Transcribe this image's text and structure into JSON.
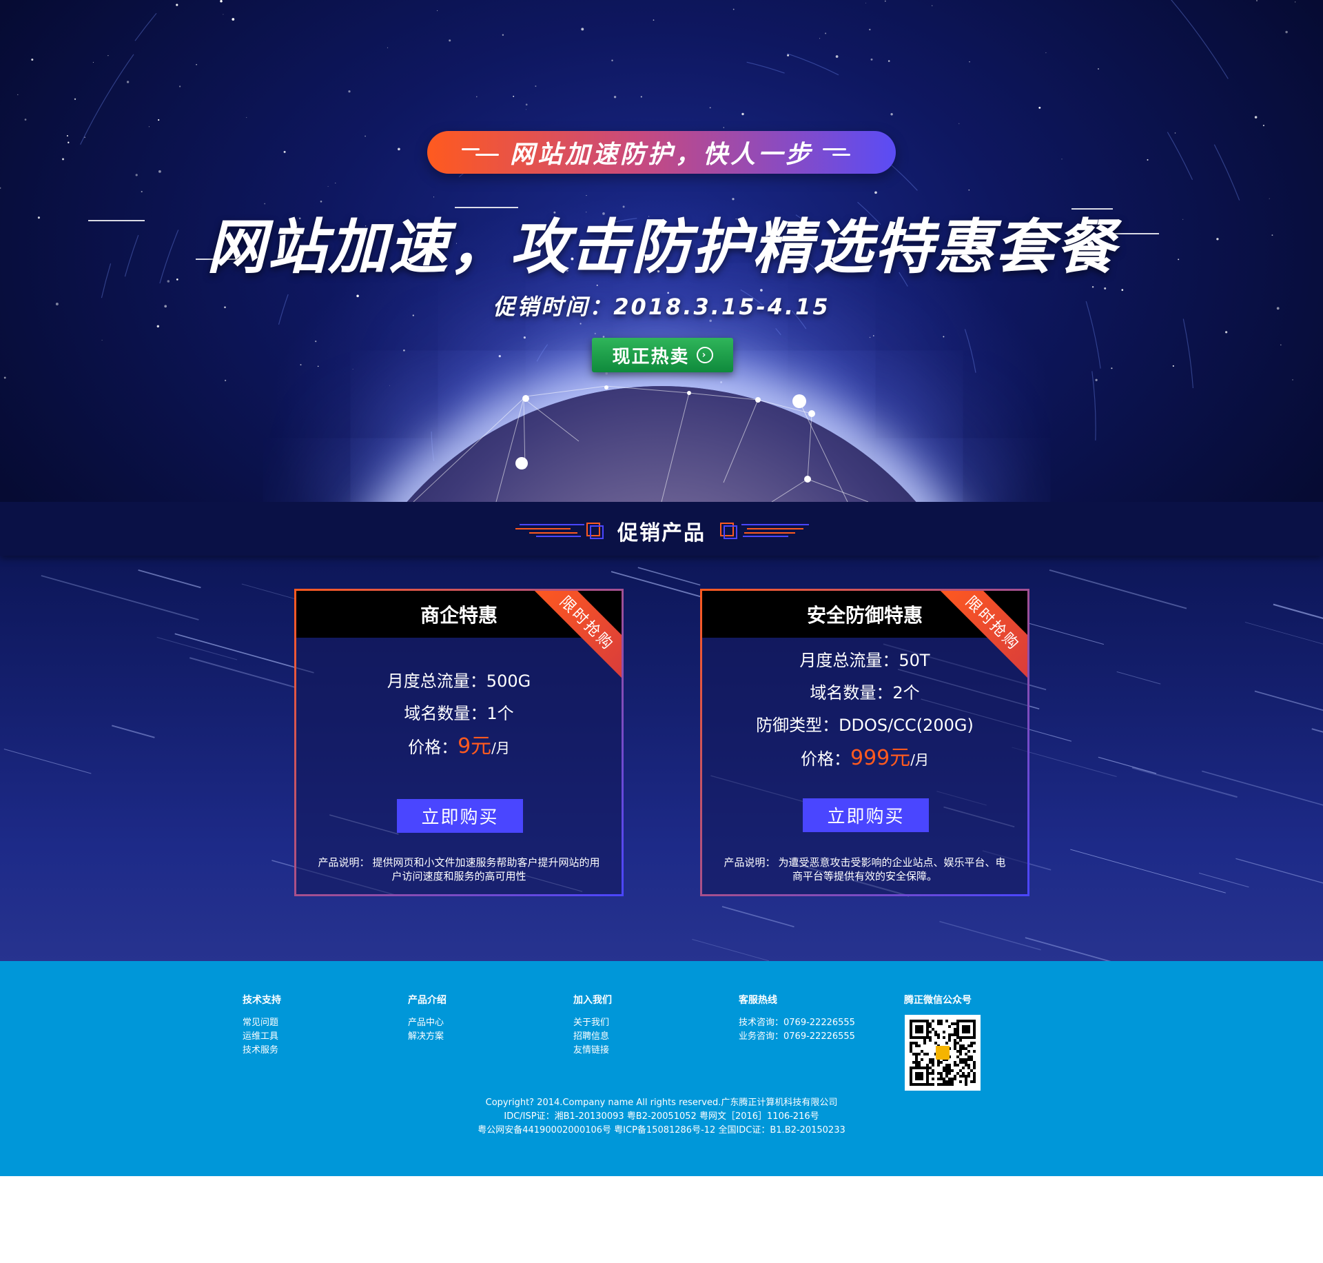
{
  "hero": {
    "tagline": "网站加速防护，快人一步",
    "headline": "网站加速，攻击防护精选特惠套餐",
    "promo_time": "促销时间：2018.3.15-4.15",
    "hot_button": "现正热卖"
  },
  "section": {
    "title": "促销产品"
  },
  "cards": [
    {
      "title": "商企特惠",
      "ribbon": "限时抢购",
      "specs": [
        "月度总流量：500G",
        "域名数量：1个"
      ],
      "price_label": "价格：",
      "price_value": "9元",
      "price_unit": "/月",
      "buy": "立即购买",
      "desc_label": "产品说明：",
      "desc": "提供网页和小文件加速服务帮助客户提升网站的用户访问速度和服务的高可用性"
    },
    {
      "title": "安全防御特惠",
      "ribbon": "限时抢购",
      "specs": [
        "月度总流量：50T",
        "域名数量：2个",
        "防御类型：DDOS/CC(200G)"
      ],
      "price_label": "价格：",
      "price_value": "999元",
      "price_unit": "/月",
      "buy": "立即购买",
      "desc_label": "产品说明：",
      "desc": "为遭受恶意攻击受影响的企业站点、娱乐平台、电商平台等提供有效的安全保障。"
    }
  ],
  "footer": {
    "columns": [
      {
        "title": "技术支持",
        "links": [
          "常见问题",
          "运维工具",
          "技术服务"
        ]
      },
      {
        "title": "产品介绍",
        "links": [
          "产品中心",
          "解决方案"
        ]
      },
      {
        "title": "加入我们",
        "links": [
          "关于我们",
          "招聘信息",
          "友情链接"
        ]
      },
      {
        "title": "客服热线",
        "links": [
          "技术咨询：0769-22226555",
          "业务咨询：0769-22226555"
        ]
      },
      {
        "title": "腾正微信公众号",
        "links": []
      }
    ],
    "copyright": [
      "Copyright? 2014.Company name All rights reserved.广东腾正计算机科技有限公司",
      "IDC/ISP证：湘B1-20130093 粤B2-20051052 粤网文［2016］1106-216号",
      "粤公网安备44190002000106号 粤ICP备15081286号-12 全国IDC证：B1.B2-20150233"
    ]
  },
  "colors": {
    "accent_orange": "#ff5a1f",
    "accent_blue": "#4a46ff",
    "button_green": "#1a9a48",
    "footer_blue": "#0097d9",
    "hero_dark": "#0e1760"
  },
  "icons": {
    "hot_button_icon": "arrow-right-circle-icon",
    "qr_code": "qr-code-icon"
  }
}
